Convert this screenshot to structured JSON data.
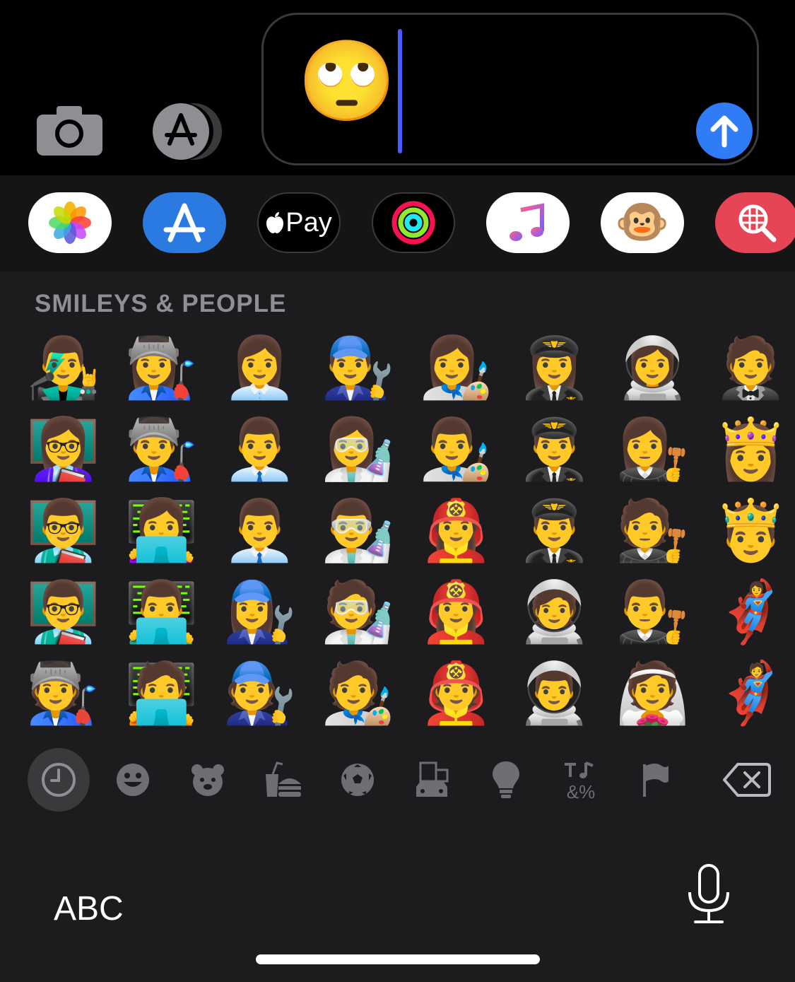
{
  "compose": {
    "message_emoji": "🙄"
  },
  "app_drawer": {
    "items": [
      {
        "name": "Photos"
      },
      {
        "name": "App Store"
      },
      {
        "name": "Apple Pay",
        "label": "Pay"
      },
      {
        "name": "Activity"
      },
      {
        "name": "Music"
      },
      {
        "name": "Animoji"
      },
      {
        "name": "Images"
      }
    ]
  },
  "emoji_keyboard": {
    "section_title": "SMILEYS & PEOPLE",
    "rows": [
      [
        "👨‍🎤",
        "👩‍🏭",
        "👩‍💼",
        "👨‍🔧",
        "👩‍🎨",
        "👩‍✈️",
        "👩‍🚀",
        "🤵"
      ],
      [
        "👩‍🏫",
        "👨‍🏭",
        "👨‍💼",
        "👩‍🔬",
        "👨‍🎨",
        "👨‍✈️",
        "👩‍⚖️",
        "👸"
      ],
      [
        "👨‍🏫",
        "👩‍💻",
        "👨‍💼",
        "👨‍🔬",
        "👩‍🚒",
        "👨‍✈️",
        "🧑‍⚖️",
        "🤴"
      ],
      [
        "👨‍🏫",
        "👨‍💻",
        "👩‍🔧",
        "🧑‍🔬",
        "👩‍🚒",
        "🧑‍🚀",
        "👨‍⚖️",
        "🦸‍♀️"
      ],
      [
        "🧑‍🏭",
        "🧑‍💻",
        "🧑‍🔧",
        "🧑‍🎨",
        "🧑‍🚒",
        "👨‍🚀",
        "👰",
        "🦸"
      ]
    ],
    "categories": [
      {
        "icon": "clock-icon",
        "active": true
      },
      {
        "icon": "smiley-icon"
      },
      {
        "icon": "bear-icon"
      },
      {
        "icon": "food-icon"
      },
      {
        "icon": "soccer-ball-icon"
      },
      {
        "icon": "building-car-icon"
      },
      {
        "icon": "lightbulb-icon"
      },
      {
        "icon": "symbols-icon",
        "label": "&%"
      },
      {
        "icon": "flag-icon"
      },
      {
        "icon": "delete-icon"
      }
    ],
    "abc_label": "ABC"
  },
  "colors": {
    "accent": "#2f7cf6",
    "caret": "#4a5cff",
    "keyboard_bg": "#1c1c1e",
    "section_text": "#8e8e93"
  }
}
